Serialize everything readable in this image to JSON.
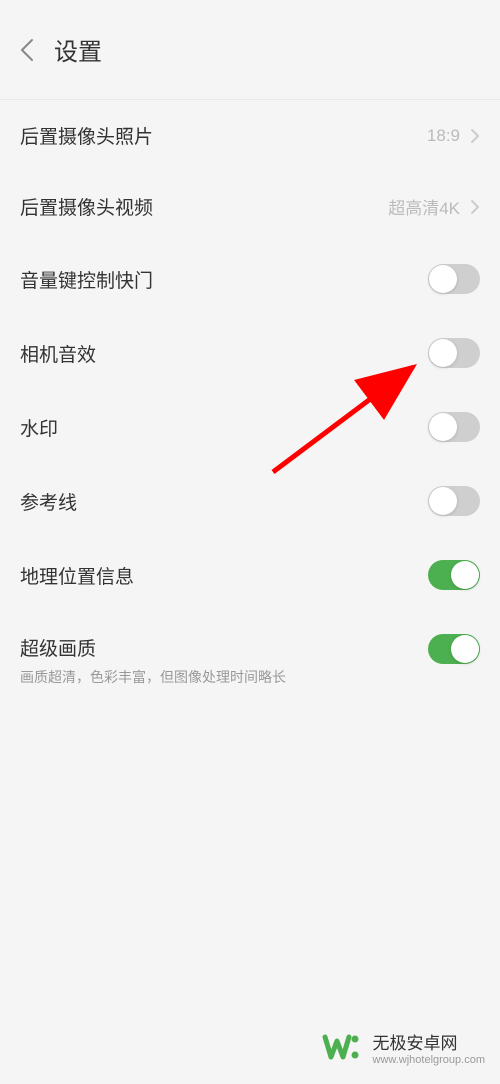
{
  "header": {
    "title": "设置"
  },
  "settings": {
    "rear_camera_photo": {
      "label": "后置摄像头照片",
      "value": "18:9"
    },
    "rear_camera_video": {
      "label": "后置摄像头视频",
      "value": "超高清4K"
    },
    "volume_shutter": {
      "label": "音量键控制快门",
      "state": "off"
    },
    "camera_sound": {
      "label": "相机音效",
      "state": "off"
    },
    "watermark": {
      "label": "水印",
      "state": "off"
    },
    "grid_lines": {
      "label": "参考线",
      "state": "off"
    },
    "location_info": {
      "label": "地理位置信息",
      "state": "on"
    },
    "super_quality": {
      "label": "超级画质",
      "subtitle": "画质超清，色彩丰富，但图像处理时间略长",
      "state": "on"
    }
  },
  "watermark_brand": {
    "title": "无极安卓网",
    "url": "www.wjhotelgroup.com"
  },
  "colors": {
    "toggle_on": "#4caf50",
    "toggle_off": "#cfcfcf",
    "arrow": "#ff0000"
  }
}
